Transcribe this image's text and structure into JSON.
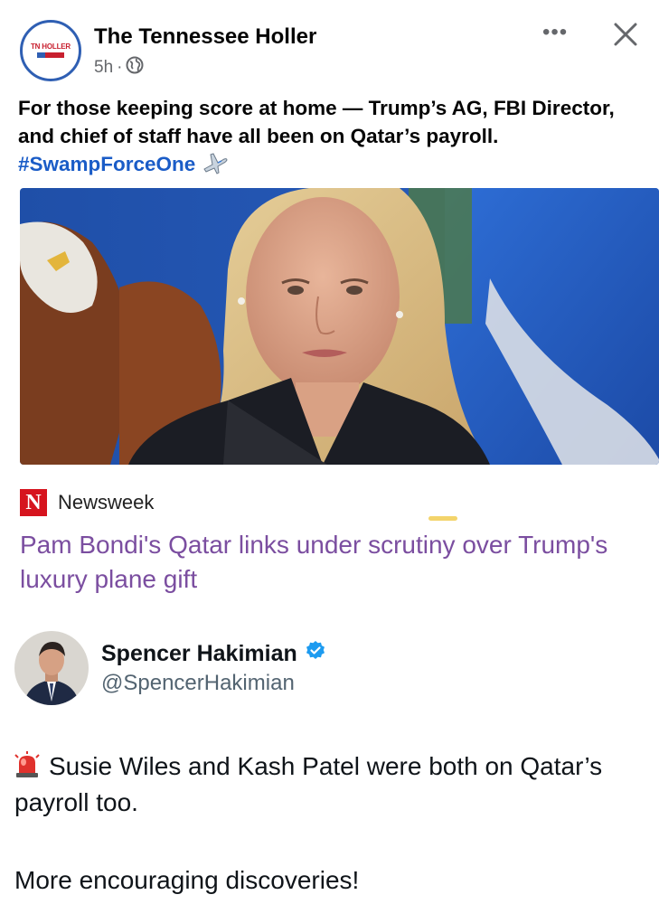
{
  "post": {
    "page_name": "The Tennessee Holler",
    "logo_text": "TN HOLLER",
    "time": "5h",
    "separator": "·",
    "more_label": "•••",
    "caption_text": "For those keeping score at home — Trump’s AG, FBI Director, and chief of staff have all been on Qatar’s payroll.",
    "hashtag": "#SwampForceOne"
  },
  "news": {
    "source": "Newsweek",
    "logo_letter": "N",
    "headline": "Pam Bondi's Qatar links under scrutiny over Trump's luxury plane gift"
  },
  "tweet": {
    "name": "Spencer Hakimian",
    "handle": "@SpencerHakimian",
    "body": "Susie Wiles and Kash Patel were both on Qatar’s payroll too.",
    "line2": "More encouraging discoveries!"
  },
  "colors": {
    "hashtag": "#1a5cc7",
    "headline": "#7b4ea0",
    "verified": "#1d9bf0",
    "newsweek_red": "#d6141e"
  },
  "icons": [
    "globe-icon",
    "more-icon",
    "close-icon",
    "airplane-icon",
    "verified-badge-icon",
    "siren-icon"
  ]
}
